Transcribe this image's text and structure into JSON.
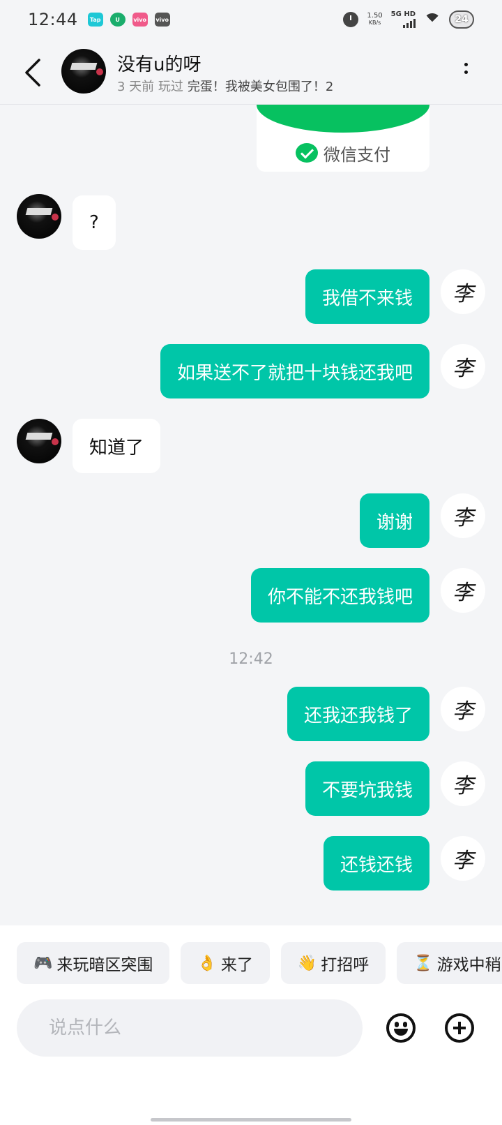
{
  "status_bar": {
    "time": "12:44",
    "notifications": [
      {
        "icon": "taptap-icon",
        "label": "Tap",
        "color": "#1ec8d6"
      },
      {
        "icon": "wechat-mini-icon",
        "label": "U",
        "color": "#1aad6c"
      },
      {
        "icon": "app-pink-icon",
        "label": "vivo",
        "color": "#f05a8a"
      },
      {
        "icon": "vivo-icon",
        "label": "vivo",
        "color": "#555555"
      }
    ],
    "net_speed_value": "1.50",
    "net_speed_unit": "KB/s",
    "network": "5G HD",
    "battery": "24"
  },
  "header": {
    "name": "没有u的呀",
    "subtitle_time": "3 天前 玩过",
    "subtitle_game": "完蛋！我被美女包围了！2"
  },
  "payment_card": {
    "label": "微信支付",
    "accent": "#07c160"
  },
  "messages": [
    {
      "from": "peer",
      "text": "?"
    },
    {
      "from": "me",
      "text": "我借不来钱"
    },
    {
      "from": "me",
      "text": "如果送不了就把十块钱还我吧"
    },
    {
      "from": "peer",
      "text": "知道了"
    },
    {
      "from": "me",
      "text": "谢谢"
    },
    {
      "from": "me",
      "text": "你不能不还我钱吧"
    },
    {
      "from": "me",
      "text": "还我还我钱了"
    },
    {
      "from": "me",
      "text": "不要坑我钱"
    },
    {
      "from": "me",
      "text": "还钱还钱"
    }
  ],
  "timestamp": "12:42",
  "my_avatar_glyph": "李",
  "quick_replies": [
    {
      "emoji": "🎮",
      "text": "来玩暗区突围"
    },
    {
      "emoji": "👌",
      "text": "来了"
    },
    {
      "emoji": "👋",
      "text": "打招呼"
    },
    {
      "emoji": "⏳",
      "text": "游戏中稍"
    }
  ],
  "input": {
    "placeholder": "说点什么"
  },
  "colors": {
    "my_bubble": "#00c6a8",
    "peer_bubble": "#ffffff",
    "background": "#f4f5f7"
  }
}
